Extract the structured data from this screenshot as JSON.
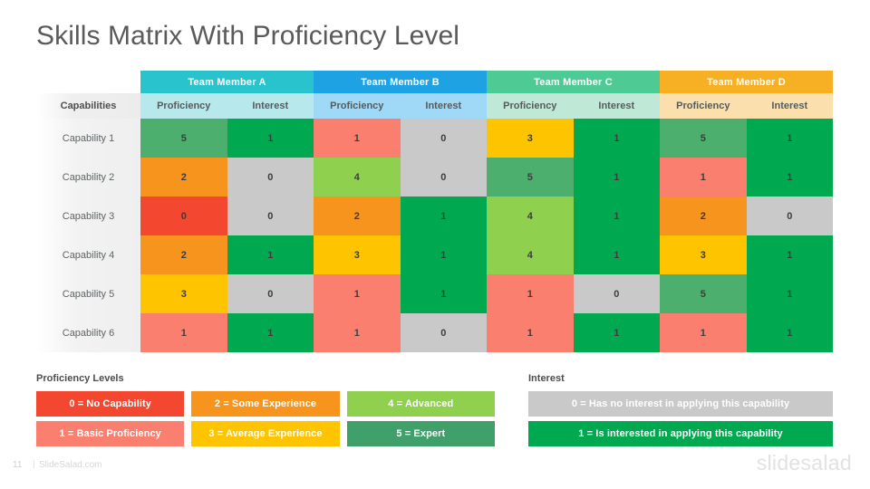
{
  "page_title": "Skills Matrix With Proficiency Level",
  "matrix": {
    "corner_label": "Capabilities",
    "teams": [
      {
        "label": "Team Member A",
        "header_color": "#29c3ce",
        "sub_color": "#b7e8ec"
      },
      {
        "label": "Team Member B",
        "header_color": "#1ea2e3",
        "sub_color": "#9fd9f7"
      },
      {
        "label": "Team Member C",
        "header_color": "#4ecb95",
        "sub_color": "#bfe9d6"
      },
      {
        "label": "Team Member D",
        "header_color": "#f7b023",
        "sub_color": "#fbe0ae"
      }
    ],
    "sub_headers": [
      "Proficiency",
      "Interest"
    ],
    "rows": [
      {
        "label": "Capability 1",
        "cells": [
          {
            "value": "5",
            "color": "#4caf6e"
          },
          {
            "value": "1",
            "color": "#00a94f"
          },
          {
            "value": "1",
            "color": "#fb7f6e"
          },
          {
            "value": "0",
            "color": "#c9c9c9"
          },
          {
            "value": "3",
            "color": "#ffc400"
          },
          {
            "value": "1",
            "color": "#00a94f"
          },
          {
            "value": "5",
            "color": "#4caf6e"
          },
          {
            "value": "1",
            "color": "#00a94f"
          }
        ]
      },
      {
        "label": "Capability 2",
        "cells": [
          {
            "value": "2",
            "color": "#f7941e"
          },
          {
            "value": "0",
            "color": "#c9c9c9"
          },
          {
            "value": "4",
            "color": "#8fd14f"
          },
          {
            "value": "0",
            "color": "#c9c9c9"
          },
          {
            "value": "5",
            "color": "#4caf6e"
          },
          {
            "value": "1",
            "color": "#00a94f"
          },
          {
            "value": "1",
            "color": "#fb7f6e"
          },
          {
            "value": "1",
            "color": "#00a94f"
          }
        ]
      },
      {
        "label": "Capability 3",
        "cells": [
          {
            "value": "0",
            "color": "#f4472f"
          },
          {
            "value": "0",
            "color": "#c9c9c9"
          },
          {
            "value": "2",
            "color": "#f7941e"
          },
          {
            "value": "1",
            "color": "#00a94f"
          },
          {
            "value": "4",
            "color": "#8fd14f"
          },
          {
            "value": "1",
            "color": "#00a94f"
          },
          {
            "value": "2",
            "color": "#f7941e"
          },
          {
            "value": "0",
            "color": "#c9c9c9"
          }
        ]
      },
      {
        "label": "Capability 4",
        "cells": [
          {
            "value": "2",
            "color": "#f7941e"
          },
          {
            "value": "1",
            "color": "#00a94f"
          },
          {
            "value": "3",
            "color": "#ffc400"
          },
          {
            "value": "1",
            "color": "#00a94f"
          },
          {
            "value": "4",
            "color": "#8fd14f"
          },
          {
            "value": "1",
            "color": "#00a94f"
          },
          {
            "value": "3",
            "color": "#ffc400"
          },
          {
            "value": "1",
            "color": "#00a94f"
          }
        ]
      },
      {
        "label": "Capability 5",
        "cells": [
          {
            "value": "3",
            "color": "#ffc400"
          },
          {
            "value": "0",
            "color": "#c9c9c9"
          },
          {
            "value": "1",
            "color": "#fb7f6e"
          },
          {
            "value": "1",
            "color": "#00a94f"
          },
          {
            "value": "1",
            "color": "#fb7f6e"
          },
          {
            "value": "0",
            "color": "#c9c9c9"
          },
          {
            "value": "5",
            "color": "#4caf6e"
          },
          {
            "value": "1",
            "color": "#00a94f"
          }
        ]
      },
      {
        "label": "Capability 6",
        "cells": [
          {
            "value": "1",
            "color": "#fb7f6e"
          },
          {
            "value": "1",
            "color": "#00a94f"
          },
          {
            "value": "1",
            "color": "#fb7f6e"
          },
          {
            "value": "0",
            "color": "#c9c9c9"
          },
          {
            "value": "1",
            "color": "#fb7f6e"
          },
          {
            "value": "1",
            "color": "#00a94f"
          },
          {
            "value": "1",
            "color": "#fb7f6e"
          },
          {
            "value": "1",
            "color": "#00a94f"
          }
        ]
      }
    ]
  },
  "proficiency_legend": {
    "title": "Proficiency Levels",
    "items": [
      {
        "label": "0 = No Capability",
        "color": "#f4472f"
      },
      {
        "label": "2 = Some Experience",
        "color": "#f7941e"
      },
      {
        "label": "4 = Advanced",
        "color": "#8fd14f"
      },
      {
        "label": "1 = Basic Proficiency",
        "color": "#fb7f6e"
      },
      {
        "label": "3 = Average Experience",
        "color": "#ffc400"
      },
      {
        "label": "5 = Expert",
        "color": "#3fa169"
      }
    ]
  },
  "interest_legend": {
    "title": "Interest",
    "items": [
      {
        "label": "0 = Has no interest in applying this capability",
        "color": "#c9c9c9"
      },
      {
        "label": "1 = Is interested in applying this capability",
        "color": "#00a94f"
      }
    ]
  },
  "footer": {
    "page_number": "11",
    "divider": "|",
    "site": "SlideSalad.com",
    "brand": "slidesalad"
  }
}
